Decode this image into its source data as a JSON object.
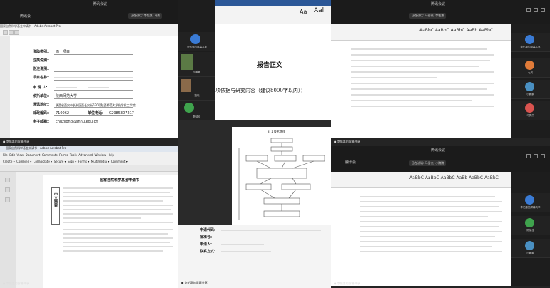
{
  "meeting": {
    "app_title": "腾讯会议",
    "tile_tl_brand": "腾讯会",
    "tile_tr_title": "腾讯会议",
    "tile_tr_speaking": "正在讲话: 马秀杰; 李佑惠",
    "tile_br_title": "腾讯会议",
    "tile_br_speaking": "正在讲话: 马秀杰; 小鹏鹏",
    "tile_br_brand": "腾讯会",
    "tile_tl_speaking": "正在讲话: 李佑惠; 马秀",
    "share_label_left": "李佑惠的屏幕共享",
    "share_label_right": "李佑惠的屏幕共享",
    "share_label_bl": "李佑惠的屏幕共享",
    "share_label_bm": "李佑惠的屏幕共享",
    "share_label_br": "李佑惠的屏幕共享"
  },
  "participants_left": [
    {
      "name": "李佑惠的屏幕共享"
    },
    {
      "name": "小鹏鹏"
    },
    {
      "name": "路晓"
    },
    {
      "name": "陈徐佳"
    }
  ],
  "participants_right": [
    {
      "name": "李佑惠的屏幕共享"
    },
    {
      "name": "七风"
    },
    {
      "name": "小鹏鹏"
    },
    {
      "name": "马秀杰"
    }
  ],
  "participants_right_bottom": [
    {
      "name": "李佑惠的屏幕共享"
    },
    {
      "name": "陈徐佳"
    },
    {
      "name": "小鹏鹏"
    }
  ],
  "form_doc": {
    "window_title": "国家自然科学基金申请书 - Adobe Acrobat Pro",
    "fields": [
      {
        "label": "资助类别:",
        "value": "面上项目"
      },
      {
        "label": "亚类说明:",
        "value": ""
      },
      {
        "label": "附注说明:",
        "value": ""
      },
      {
        "label": "项目名称:",
        "value": ""
      },
      {
        "label": "申 请 人:",
        "value": ""
      },
      {
        "label": "依托单位:",
        "value": "陕西师范大学"
      },
      {
        "label": "通讯地址:",
        "value": "陕西省西安市长安区西长安街620号陕西师范大学化学化工学院"
      },
      {
        "label": "邮政编码:",
        "value": "710062"
      },
      {
        "label": "电子邮箱:",
        "value": "chuzilong@snnu.edu.cn"
      }
    ],
    "unit_label": "单位电话:",
    "unit_value": "02985307217"
  },
  "center_doc": {
    "heading": "报告正文",
    "subheading": "项依据与研究内容（建议8000字以内）：",
    "flow_title": "3. 1 技术路线",
    "lower_fields": [
      {
        "label": "申请代码:",
        "value": ""
      },
      {
        "label": "批准号:",
        "value": ""
      },
      {
        "label": "申请人:",
        "value": ""
      },
      {
        "label": "联系方式:",
        "value": ""
      }
    ]
  },
  "acrobat_doc": {
    "window_title": "国家自然科学基金申请书 - Adobe Acrobat Pro",
    "menu": [
      "File",
      "Edit",
      "View",
      "Document",
      "Comments",
      "Forms",
      "Tools",
      "Advanced",
      "Window",
      "Help"
    ],
    "toolbar": [
      "Create",
      "Combine",
      "Collaborate",
      "Secure",
      "Sign",
      "Forms",
      "Multimedia",
      "Comment"
    ],
    "doc_title": "国家自然科学基金申请书",
    "side_label": "中文摘要"
  },
  "word_doc": {
    "styles": [
      "AaBbC",
      "AaBbC",
      "AaBbC",
      "AaBb",
      "AaBbC",
      "AaBbC"
    ]
  }
}
